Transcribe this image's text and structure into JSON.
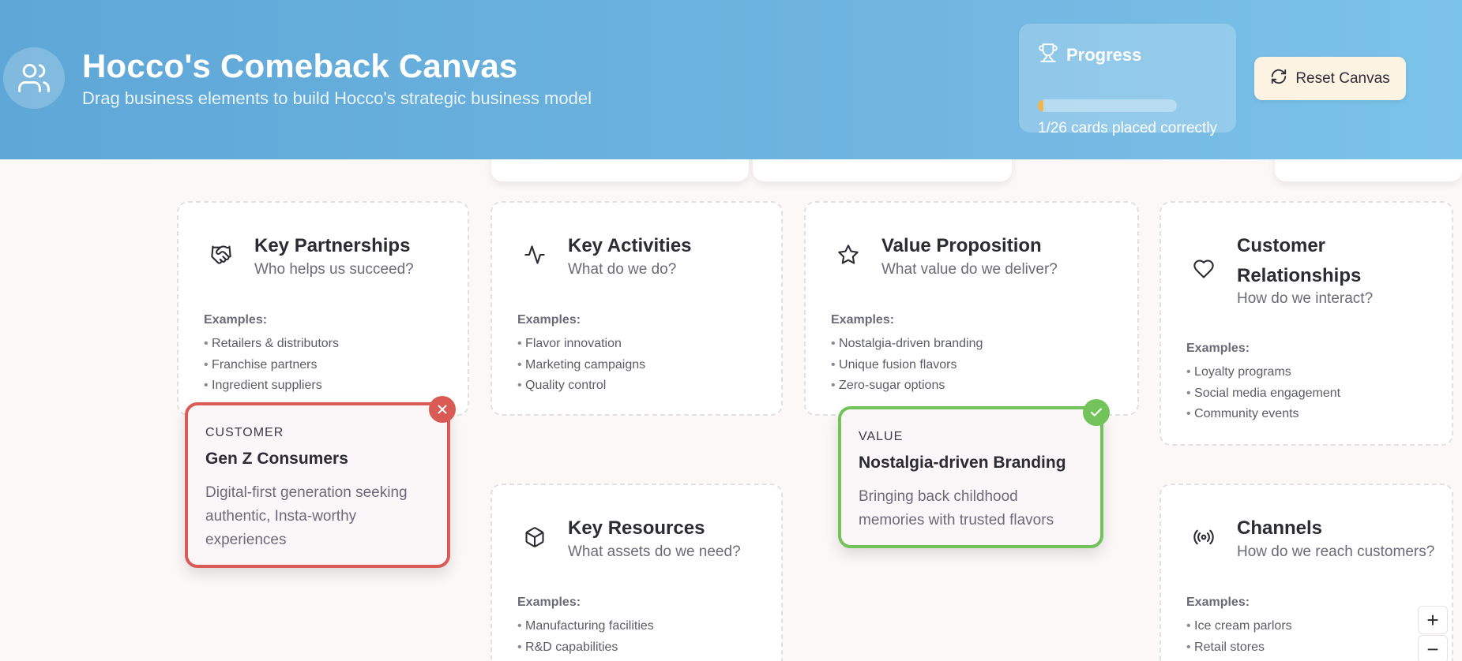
{
  "header": {
    "title": "Hocco's Comeback Canvas",
    "subtitle": "Drag business elements to build Hocco's strategic business model",
    "avatar_icon": "users-icon"
  },
  "progress": {
    "title": "Progress",
    "icon": "trophy-icon",
    "placed": 1,
    "total": 26,
    "fraction": 0.038,
    "text": "1/26 cards placed correctly",
    "bar_color": "#f1b54a"
  },
  "toolbar": {
    "reset_label": "Reset Canvas",
    "reset_icon": "refresh-icon"
  },
  "boxes": {
    "key_partnerships": {
      "title": "Key Partnerships",
      "question": "Who helps us succeed?",
      "icon": "handshake-icon",
      "examples_label": "Examples:",
      "examples": [
        "Retailers & distributors",
        "Franchise partners",
        "Ingredient suppliers"
      ]
    },
    "key_activities": {
      "title": "Key Activities",
      "question": "What do we do?",
      "icon": "activity-icon",
      "examples_label": "Examples:",
      "examples": [
        "Flavor innovation",
        "Marketing campaigns",
        "Quality control"
      ]
    },
    "value_proposition": {
      "title": "Value Proposition",
      "question": "What value do we deliver?",
      "icon": "star-icon",
      "examples_label": "Examples:",
      "examples": [
        "Nostalgia-driven branding",
        "Unique fusion flavors",
        "Zero-sugar options"
      ]
    },
    "customer_relationships": {
      "title_line1": "Customer",
      "title_line2": "Relationships",
      "question": "How do we interact?",
      "icon": "heart-icon",
      "examples_label": "Examples:",
      "examples": [
        "Loyalty programs",
        "Social media engagement",
        "Community events"
      ]
    },
    "key_resources": {
      "title": "Key Resources",
      "question": "What assets do we need?",
      "icon": "box-icon",
      "examples_label": "Examples:",
      "examples": [
        "Manufacturing facilities",
        "R&D capabilities"
      ]
    },
    "channels": {
      "title": "Channels",
      "question": "How do we reach customers?",
      "icon": "broadcast-icon",
      "examples_label": "Examples:",
      "examples": [
        "Ice cream parlors",
        "Retail stores"
      ]
    }
  },
  "cards": {
    "gen_z": {
      "category": "CUSTOMER",
      "title": "Gen Z Consumers",
      "desc_line1": "Digital-first generation seeking",
      "desc_line2": "authentic, Insta-worthy",
      "desc_line3": "experiences",
      "status": "incorrect",
      "status_icon": "close-icon",
      "color": "#da5a55"
    },
    "nostalgia": {
      "category": "VALUE",
      "title": "Nostalgia-driven Branding",
      "desc_line1": "Bringing back childhood",
      "desc_line2": "memories with trusted flavors",
      "status": "correct",
      "status_icon": "check-icon",
      "color": "#72c35a"
    }
  },
  "zoom": {
    "in_label": "+",
    "out_label": "−"
  }
}
